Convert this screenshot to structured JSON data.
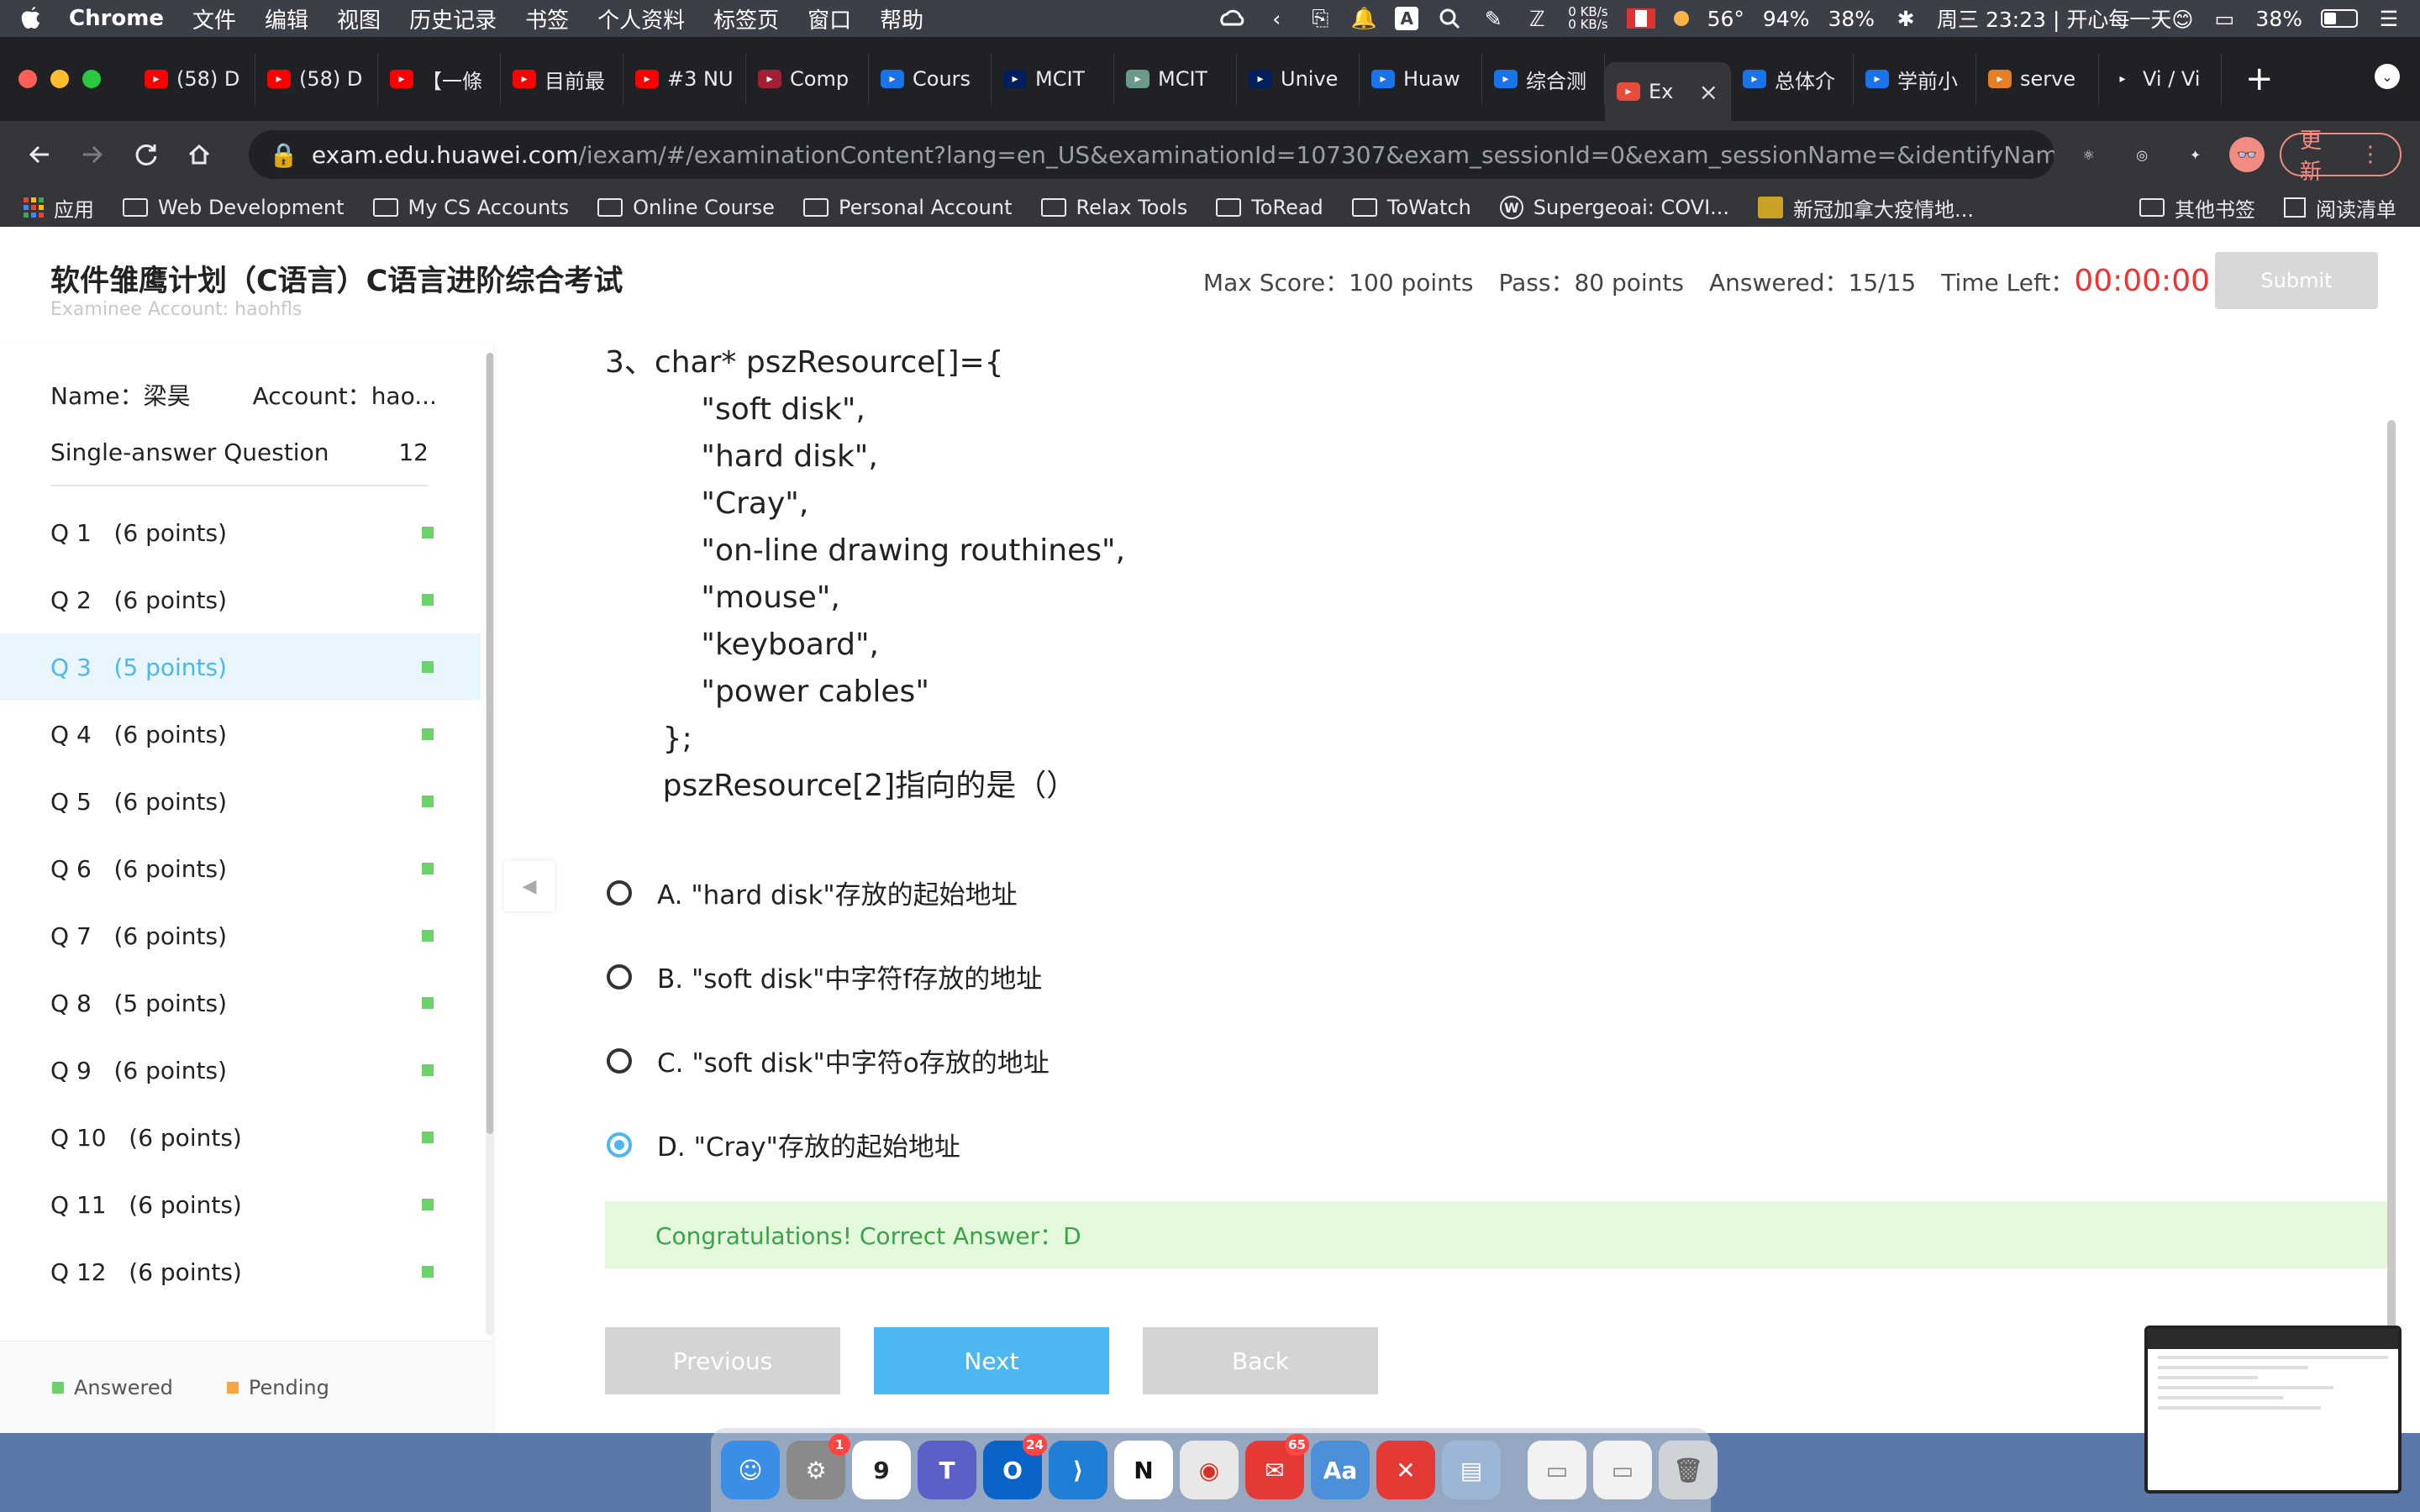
{
  "menubar": {
    "app": "Chrome",
    "items": [
      "文件",
      "编辑",
      "视图",
      "历史记录",
      "书签",
      "个人资料",
      "标签页",
      "窗口",
      "帮助"
    ],
    "net_up": "0 KB/s",
    "net_down": "0 KB/s",
    "temp": "56°",
    "battery_pct": "94%",
    "cpu_pct": "38%",
    "datetime": "周三 23:23 | 开心每一天😊",
    "battery2_pct": "38%"
  },
  "tabs": [
    {
      "title": "(58) D",
      "color": "#ff0000"
    },
    {
      "title": "(58) D",
      "color": "#ff0000"
    },
    {
      "title": "【一條",
      "color": "#ff0000"
    },
    {
      "title": "目前最",
      "color": "#ff0000"
    },
    {
      "title": "#3 NU",
      "color": "#ff0000"
    },
    {
      "title": "Comp",
      "color": "#a31f34"
    },
    {
      "title": "Cours",
      "color": "#1a73e8"
    },
    {
      "title": "MCIT",
      "color": "#011f5b"
    },
    {
      "title": "MCIT",
      "color": "#6a9a8a"
    },
    {
      "title": "Unive",
      "color": "#011f5b"
    },
    {
      "title": "Huaw",
      "color": "#1a73e8"
    },
    {
      "title": "综合测",
      "color": "#1a73e8"
    },
    {
      "title": "Ex",
      "color": "#e74c3c",
      "active": true
    },
    {
      "title": "总体介",
      "color": "#1a73e8"
    },
    {
      "title": "学前小",
      "color": "#1a73e8"
    },
    {
      "title": "serve",
      "color": "#e67e22"
    },
    {
      "title": "Vi / Vi",
      "color": "#202124"
    }
  ],
  "toolbar": {
    "url_host": "exam.edu.huawei.com",
    "url_path": "/iexam/#/examinationContent?lang=en_US&examinationId=107307&exam_sessionId=0&exam_sessionName=&identifyName=&ide...",
    "update_label": "更新"
  },
  "bookmarks": {
    "left": [
      "应用",
      "Web Development",
      "My CS Accounts",
      "Online Course",
      "Personal Account",
      "Relax Tools",
      "ToRead",
      "ToWatch",
      "Supergeoai: COVI...",
      "新冠加拿大疫情地..."
    ],
    "right": [
      "其他书签",
      "阅读清单"
    ]
  },
  "exam": {
    "title": "软件雏鹰计划（C语言）C语言进阶综合考试",
    "examinee": "Examinee Account: haohfls",
    "max_score_label": "Max Score：",
    "max_score": "100 points",
    "pass_label": "Pass：",
    "pass": "80 points",
    "answered_label": "Answered：",
    "answered": "15/15",
    "time_left_label": "Time Left：",
    "time_left": "00:00:00",
    "submit": "Submit"
  },
  "sidebar": {
    "name_label": "Name：",
    "name": "梁昊",
    "account_label": "Account：",
    "account": "hao...",
    "section": "Single-answer Question",
    "section_count": "12",
    "questions": [
      {
        "label": "Q 1   (6 points)"
      },
      {
        "label": "Q 2   (6 points)"
      },
      {
        "label": "Q 3   (5 points)",
        "active": true
      },
      {
        "label": "Q 4   (6 points)"
      },
      {
        "label": "Q 5   (6 points)"
      },
      {
        "label": "Q 6   (6 points)"
      },
      {
        "label": "Q 7   (6 points)"
      },
      {
        "label": "Q 8   (5 points)"
      },
      {
        "label": "Q 9   (6 points)"
      },
      {
        "label": "Q 10   (6 points)"
      },
      {
        "label": "Q 11   (6 points)"
      },
      {
        "label": "Q 12   (6 points)"
      }
    ],
    "legend_answered": "Answered",
    "legend_pending": "Pending",
    "answered_color": "#6cd36a",
    "pending_color": "#f5a742"
  },
  "question": {
    "text": "3、char* pszResource[]={\n          \"soft disk\",\n          \"hard disk\",\n          \"Cray\",\n          \"on-line drawing routhines\",\n          \"mouse\",\n          \"keyboard\",\n          \"power cables\"\n      };\n      pszResource[2]指向的是（）",
    "options": [
      {
        "label": "A. \"hard disk\"存放的起始地址",
        "selected": false
      },
      {
        "label": "B. \"soft disk\"中字符f存放的地址",
        "selected": false
      },
      {
        "label": "C. \"soft disk\"中字符o存放的地址",
        "selected": false
      },
      {
        "label": "D. \"Cray\"存放的起始地址",
        "selected": true
      }
    ],
    "result": "Congratulations! Correct Answer：D",
    "buttons": {
      "previous": "Previous",
      "next": "Next",
      "back": "Back"
    }
  },
  "dock": [
    {
      "name": "finder",
      "color": "#3a8ee6",
      "glyph": "☺"
    },
    {
      "name": "system-preferences",
      "color": "#8a8a8a",
      "glyph": "⚙",
      "badge": "1"
    },
    {
      "name": "calendar",
      "color": "#ffffff",
      "glyph": "9",
      "text_color": "#222"
    },
    {
      "name": "teams",
      "color": "#5b5fc7",
      "glyph": "T"
    },
    {
      "name": "outlook",
      "color": "#0a64c8",
      "glyph": "O",
      "badge": "24"
    },
    {
      "name": "vscode",
      "color": "#1f7ed6",
      "glyph": "⟩"
    },
    {
      "name": "notion",
      "color": "#ffffff",
      "glyph": "N",
      "text_color": "#111"
    },
    {
      "name": "chrome",
      "color": "#e8e8e8",
      "glyph": "◉",
      "text_color": "#d93025"
    },
    {
      "name": "mail",
      "color": "#e53935",
      "glyph": "✉",
      "badge": "65"
    },
    {
      "name": "dictionary",
      "color": "#4a8fd8",
      "glyph": "Aa"
    },
    {
      "name": "xmind",
      "color": "#e53935",
      "glyph": "✕"
    },
    {
      "name": "preview",
      "color": "#9cb6d6",
      "glyph": "▤"
    },
    {
      "name": "document-1",
      "color": "#f2f2f2",
      "glyph": "▭",
      "text_color": "#888"
    },
    {
      "name": "document-2",
      "color": "#f2f2f2",
      "glyph": "▭",
      "text_color": "#888"
    },
    {
      "name": "trash",
      "color": "#cfd3d8",
      "glyph": "🗑",
      "text_color": "#666"
    }
  ]
}
